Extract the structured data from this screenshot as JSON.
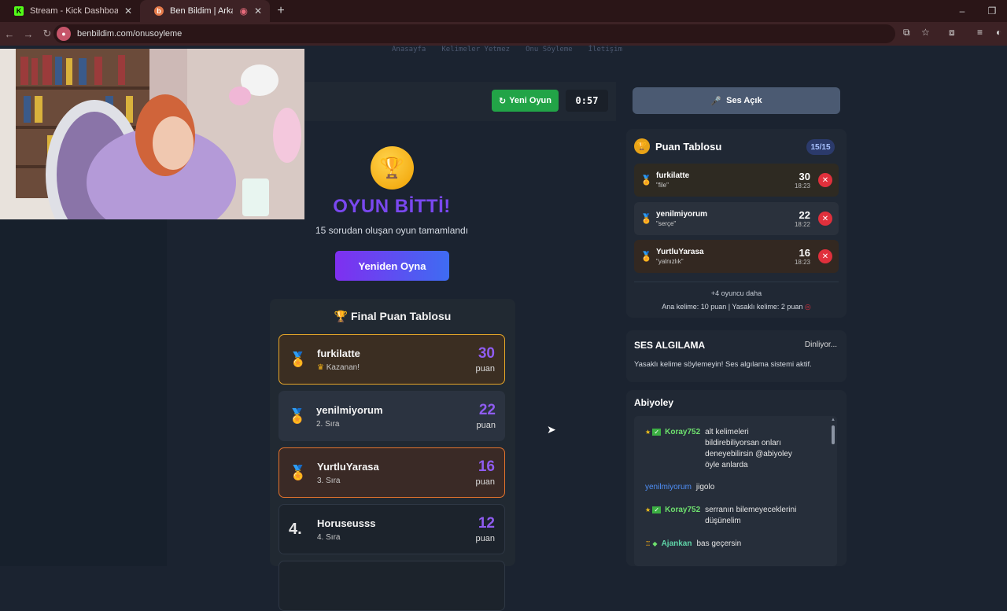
{
  "browser": {
    "tabs": [
      {
        "title": "Stream - Kick Dashboard",
        "icon": "kick-logo-icon",
        "close": "✕"
      },
      {
        "title": "Ben Bildim | Arkadaşlarınla ...",
        "icon": "benbildim-logo-icon",
        "close": "✕"
      }
    ],
    "new_tab": "+",
    "url": "benbildim.com/onusoyleme"
  },
  "nav": {
    "links": [
      "Anasayfa",
      "Kelimeler Yetmez",
      "Onu Söyleme",
      "İletişim"
    ]
  },
  "game": {
    "new_game_label": "Yeni Oyun",
    "timer": "0:57",
    "over_title": "OYUN BİTTİ!",
    "over_subtitle": "15 sorudan oluşan oyun tamamlandı",
    "replay_label": "Yeniden Oyna"
  },
  "final_board": {
    "title": "Final Puan Tablosu",
    "unit": "puan",
    "rows": [
      {
        "name": "furkilatte",
        "sub": "Kazanan!",
        "score": "30",
        "rank": "1"
      },
      {
        "name": "yenilmiyorum",
        "sub": "2. Sıra",
        "score": "22",
        "rank": "2"
      },
      {
        "name": "YurtluYarasa",
        "sub": "3. Sıra",
        "score": "16",
        "rank": "3"
      },
      {
        "name": "Horuseusss",
        "sub": "4. Sıra",
        "score": "12",
        "rank": "4."
      }
    ]
  },
  "sidebar": {
    "sound_label": "Ses Açık",
    "scoreboard": {
      "title": "Puan Tablosu",
      "count": "15/15",
      "rows": [
        {
          "name": "furkilatte",
          "word": "\"file\"",
          "score": "30",
          "time": "18:23"
        },
        {
          "name": "yenilmiyorum",
          "word": "\"serçe\"",
          "score": "22",
          "time": "18:22"
        },
        {
          "name": "YurtluYarasa",
          "word": "\"yalnızlık\"",
          "score": "16",
          "time": "18:23"
        }
      ],
      "more": "+4 oyuncu daha",
      "rules": "Ana kelime: 10 puan | Yasaklı kelime: 2 puan"
    },
    "voice": {
      "title": "SES ALGILAMA",
      "status": "Dinliyor...",
      "desc": "Yasaklı kelime söylemeyin! Ses algılama sistemi aktif."
    },
    "chat": {
      "title": "Abiyoley",
      "messages": [
        {
          "user": "Koray752",
          "text": "alt kelimeleri bildirebiliyorsan onları deneyebilirsin @abiyoley öyle anlarda"
        },
        {
          "user": "yenilmiyorum",
          "text": "jigolo"
        },
        {
          "user": "Koray752",
          "text": "serranın bilemeyeceklerini düşünelim"
        },
        {
          "user": "Ajankan",
          "text": "bas geçersin"
        }
      ]
    }
  },
  "colors": {
    "accent_purple": "#7a48f0",
    "green_button": "#22a447",
    "gold": "#e8a317",
    "delete_red": "#e0303c"
  }
}
